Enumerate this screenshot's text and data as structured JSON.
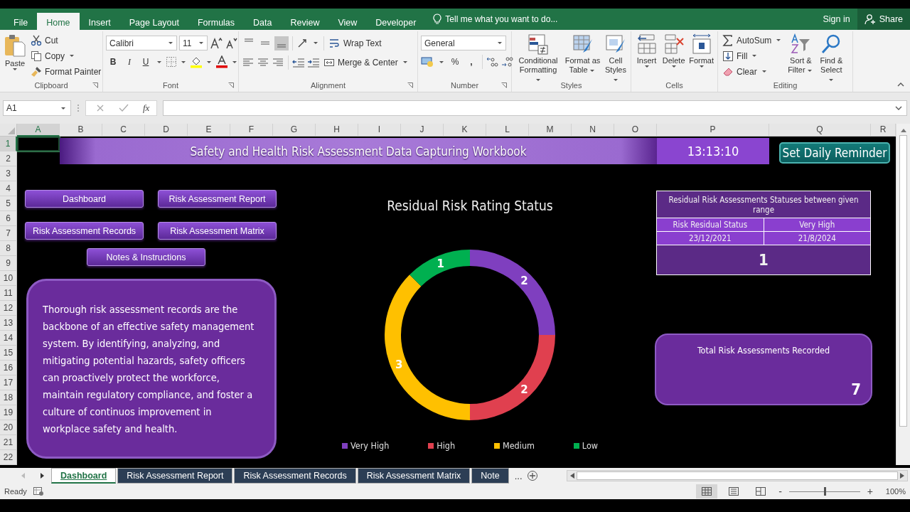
{
  "ribbon_tabs": [
    {
      "label": "File",
      "selected": false
    },
    {
      "label": "Home",
      "selected": true
    },
    {
      "label": "Insert",
      "selected": false
    },
    {
      "label": "Page Layout",
      "selected": false
    },
    {
      "label": "Formulas",
      "selected": false
    },
    {
      "label": "Data",
      "selected": false
    },
    {
      "label": "Review",
      "selected": false
    },
    {
      "label": "View",
      "selected": false
    },
    {
      "label": "Developer",
      "selected": false
    }
  ],
  "tell_me": {
    "placeholder": "Tell me what you want to do..."
  },
  "account": {
    "sign_in": "Sign in",
    "share": "Share"
  },
  "ribbon": {
    "clipboard": {
      "label": "Clipboard",
      "paste": "Paste",
      "cut": "Cut",
      "copy": "Copy",
      "format_painter": "Format Painter"
    },
    "font": {
      "label": "Font",
      "font_name": "Calibri",
      "font_size": "11",
      "bold": "B",
      "italic": "I",
      "underline": "U"
    },
    "alignment": {
      "label": "Alignment",
      "vertical_align": [
        {
          "selected": false
        },
        {
          "selected": false
        },
        {
          "selected": true
        }
      ],
      "wrap_text": "Wrap Text",
      "merge_center": "Merge & Center"
    },
    "number": {
      "label": "Number",
      "format": "General",
      "percent": "%",
      "comma": ","
    },
    "styles": {
      "label": "Styles",
      "conditional_formatting": "Conditional Formatting",
      "format_as_table": "Format as Table",
      "cell_styles": "Cell Styles"
    },
    "cells": {
      "label": "Cells",
      "insert": "Insert",
      "delete": "Delete",
      "format": "Format"
    },
    "editing": {
      "label": "Editing",
      "autosum": "AutoSum",
      "fill": "Fill",
      "clear": "Clear",
      "sort_filter": "Sort & Filter",
      "find_select": "Find & Select"
    }
  },
  "formula_bar": {
    "name_box": "A1",
    "fx": "fx"
  },
  "columns": [
    {
      "label": "A",
      "selected": true
    },
    {
      "label": "B",
      "selected": false
    },
    {
      "label": "C",
      "selected": false
    },
    {
      "label": "D",
      "selected": false
    },
    {
      "label": "E",
      "selected": false
    },
    {
      "label": "F",
      "selected": false
    },
    {
      "label": "G",
      "selected": false
    },
    {
      "label": "H",
      "selected": false
    },
    {
      "label": "I",
      "selected": false
    },
    {
      "label": "J",
      "selected": false
    },
    {
      "label": "K",
      "selected": false
    },
    {
      "label": "L",
      "selected": false
    },
    {
      "label": "M",
      "selected": false
    },
    {
      "label": "N",
      "selected": false
    },
    {
      "label": "O",
      "selected": false
    },
    {
      "label": "P",
      "selected": false
    },
    {
      "label": "Q",
      "selected": false
    },
    {
      "label": "R",
      "selected": false
    }
  ],
  "rows": [
    {
      "label": "1",
      "selected": true
    },
    {
      "label": "2",
      "selected": false
    },
    {
      "label": "3",
      "selected": false
    },
    {
      "label": "4",
      "selected": false
    },
    {
      "label": "5",
      "selected": false
    },
    {
      "label": "6",
      "selected": false
    },
    {
      "label": "7",
      "selected": false
    },
    {
      "label": "8",
      "selected": false
    },
    {
      "label": "9",
      "selected": false
    },
    {
      "label": "10",
      "selected": false
    },
    {
      "label": "11",
      "selected": false
    },
    {
      "label": "12",
      "selected": false
    },
    {
      "label": "13",
      "selected": false
    },
    {
      "label": "14",
      "selected": false
    },
    {
      "label": "15",
      "selected": false
    },
    {
      "label": "16",
      "selected": false
    },
    {
      "label": "17",
      "selected": false
    },
    {
      "label": "18",
      "selected": false
    },
    {
      "label": "19",
      "selected": false
    },
    {
      "label": "20",
      "selected": false
    },
    {
      "label": "21",
      "selected": false
    },
    {
      "label": "22",
      "selected": false
    }
  ],
  "dashboard": {
    "title": "Safety and Health Risk Assessment Data Capturing Workbook",
    "clock": "13:13:10",
    "reminder_button": "Set Daily Reminder",
    "nav_buttons": [
      "Dashboard",
      "Risk Assessment Report",
      "Risk Assessment Records",
      "Risk Assessment Matrix",
      "Notes & Instructions"
    ],
    "note": "Thorough risk assessment records are the backbone of an effective safety management system. By identifying, analyzing, and mitigating potential hazards, safety officers can proactively protect the workforce, maintain regulatory compliance, and foster a culture of continuos improvement in workplace safety and health.",
    "chart": {
      "chart_data": {
        "type": "donut",
        "title": "Residual Risk Rating Status",
        "values": [
          2,
          2,
          3,
          1
        ],
        "data_labels": true
      },
      "legend": [
        {
          "label": "Very High",
          "color": "#7f3fbf"
        },
        {
          "label": "High",
          "color": "#e0404f"
        },
        {
          "label": "Medium",
          "color": "#ffc000"
        },
        {
          "label": "Low",
          "color": "#00b050"
        }
      ]
    },
    "range_table": {
      "title": "Residual Risk Assessments Statuses between given range",
      "cells": [
        [
          "Risk Residual Status",
          "Very High"
        ],
        [
          "23/12/2021",
          "21/8/2024"
        ]
      ],
      "result": "1"
    },
    "total": {
      "label": "Total Risk Assessments Recorded",
      "value": "7"
    }
  },
  "sheet_tabs": [
    {
      "label": "Dashboard",
      "selected": true
    },
    {
      "label": "Risk Assessment Report",
      "selected": false
    },
    {
      "label": "Risk Assessment Records",
      "selected": false
    },
    {
      "label": "Risk Assessment Matrix",
      "selected": false
    },
    {
      "label": "Note",
      "selected": false
    }
  ],
  "more_tabs": "...",
  "status_bar": {
    "status": "Ready",
    "views": [
      {
        "selected": true
      },
      {
        "selected": false
      },
      {
        "selected": false
      }
    ],
    "zoom_out": "-",
    "zoom_slider": {
      "level": 0.5
    },
    "zoom_in": "+",
    "zoom": "100%"
  }
}
